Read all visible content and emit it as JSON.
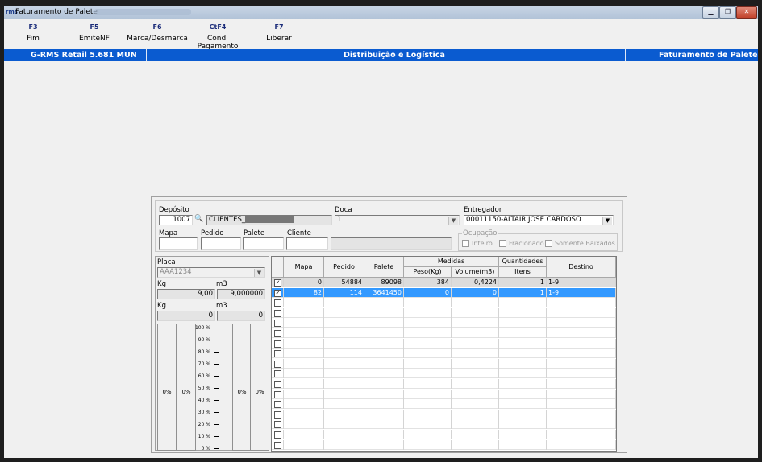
{
  "window": {
    "app_icon": "rms-icon",
    "title": "Faturamento de Palete",
    "controls": [
      "minimize",
      "restore",
      "close"
    ]
  },
  "fkeys": [
    {
      "key": "F3",
      "label": "Fim"
    },
    {
      "key": "F5",
      "label": "EmiteNF"
    },
    {
      "key": "F6",
      "label": "Marca/Desmarca"
    },
    {
      "key": "CtF4",
      "label": "Cond. Pagamento"
    },
    {
      "key": "F7",
      "label": "Liberar"
    }
  ],
  "header": {
    "system": "G-RMS Retail 5.681 MUN",
    "module": "Distribuição e Logística",
    "screen": "Faturamento de Palete",
    "bar_color": "#0a5bd0"
  },
  "form": {
    "deposito_label": "Depósito",
    "deposito_value": "1007",
    "deposito_name": "CLIENTES_",
    "doca_label": "Doca",
    "doca_value": "1",
    "entregador_label": "Entregador",
    "entregador_value": "00011150-ALTAIR JOSE CARDOSO",
    "mapa_label": "Mapa",
    "pedido_label": "Pedido",
    "palete_label": "Palete",
    "cliente_label": "Cliente",
    "ocupacao_label": "Ocupação",
    "ocupacao_options": [
      "Inteiro",
      "Fracionado",
      "Somente Baixados"
    ]
  },
  "vehicle": {
    "placa_label": "Placa",
    "placa_value": "AAA1234",
    "kg_label": "Kg",
    "m3_label": "m3",
    "kg_value": "9,00",
    "m3_value": "9,000000",
    "kg2_label": "Kg",
    "m32_label": "m3",
    "kg2_value": "0",
    "m32_value": "0",
    "gauge_values": [
      "0%",
      "0%",
      "0%",
      "0%"
    ],
    "scale": [
      "100 %",
      "90 %",
      "80 %",
      "70 %",
      "60 %",
      "50 %",
      "40 %",
      "30 %",
      "20 %",
      "10 %",
      "0 %"
    ]
  },
  "grid": {
    "headers": {
      "mapa": "Mapa",
      "pedido": "Pedido",
      "palete": "Palete",
      "medidas": "Medidas",
      "peso": "Peso(Kg)",
      "volume": "Volume(m3)",
      "quantidades": "Quantidades",
      "itens": "Itens",
      "destino": "Destino"
    },
    "rows": [
      {
        "checked": true,
        "mapa": "0",
        "pedido": "54884",
        "palete": "89098",
        "peso": "384",
        "volume": "0,4224",
        "itens": "1",
        "destino": "1-9",
        "state": "gray"
      },
      {
        "checked": true,
        "mapa": "82",
        "pedido": "114",
        "palete": "3641450",
        "peso": "0",
        "volume": "0",
        "itens": "1",
        "destino": "1-9",
        "state": "selected"
      }
    ],
    "empty_rows": 15,
    "selected_color": "#3399ff"
  }
}
